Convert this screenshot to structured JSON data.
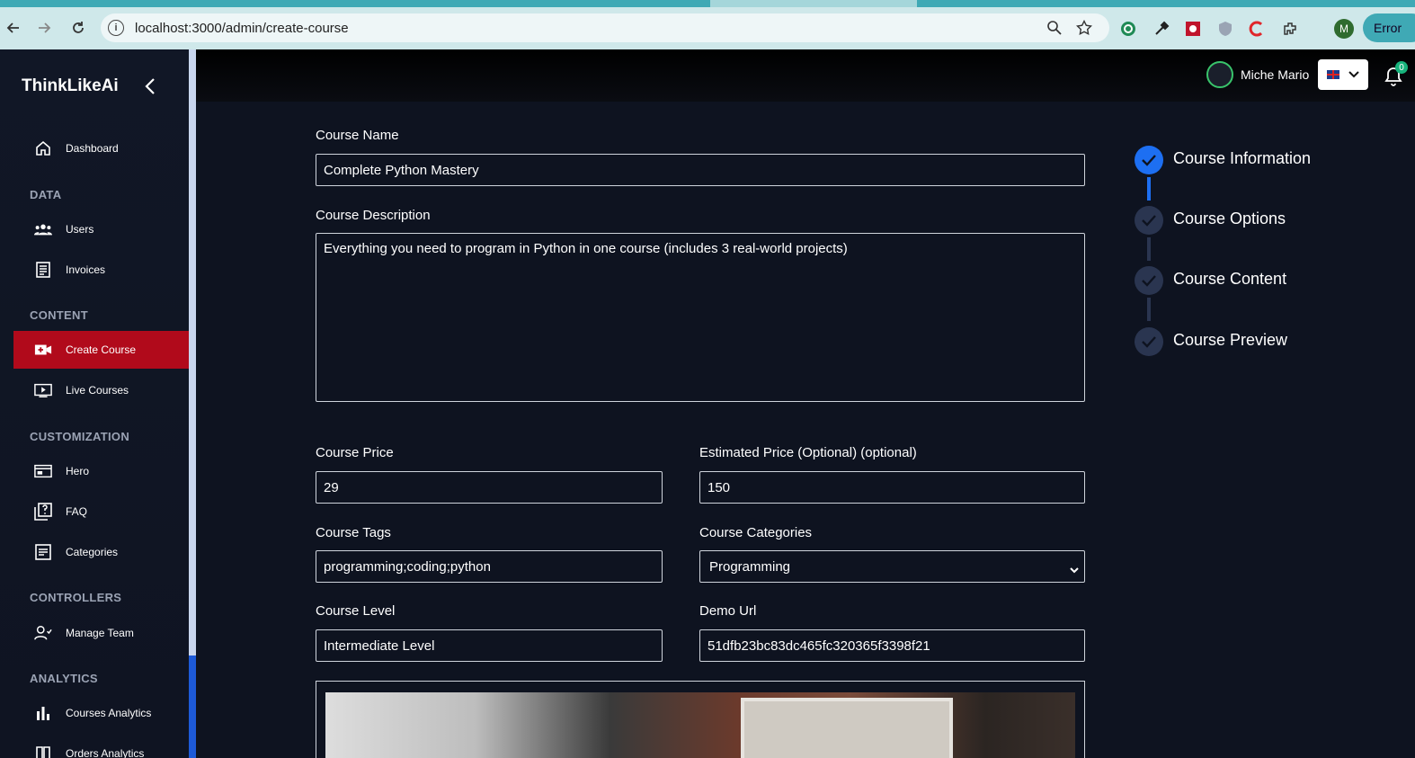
{
  "browser": {
    "url": "localhost:3000/admin/create-course",
    "profile_initial": "M",
    "error_label": "Error"
  },
  "sidebar": {
    "logo": "ThinkLikeAi",
    "sections": [
      {
        "title": "DATA"
      },
      {
        "title": "CONTENT"
      },
      {
        "title": "CUSTOMIZATION"
      },
      {
        "title": "CONTROLLERS"
      },
      {
        "title": "ANALYTICS"
      }
    ],
    "items": [
      {
        "label": "Dashboard",
        "icon": "home-icon"
      },
      {
        "label": "Users",
        "icon": "users-icon"
      },
      {
        "label": "Invoices",
        "icon": "receipt-icon"
      },
      {
        "label": "Create Course",
        "icon": "video-add-icon",
        "active": true
      },
      {
        "label": "Live Courses",
        "icon": "play-screen-icon"
      },
      {
        "label": "Hero",
        "icon": "hero-icon"
      },
      {
        "label": "FAQ",
        "icon": "quiz-icon"
      },
      {
        "label": "Categories",
        "icon": "categories-icon"
      },
      {
        "label": "Manage Team",
        "icon": "team-icon"
      },
      {
        "label": "Courses Analytics",
        "icon": "bar-chart-icon"
      },
      {
        "label": "Orders Analytics",
        "icon": "orders-icon"
      }
    ]
  },
  "topbar": {
    "user_name": "Miche Mario",
    "notification_count": "0"
  },
  "form": {
    "course_name_label": "Course Name",
    "course_name_value": "Complete Python Mastery",
    "course_description_label": "Course Description",
    "course_description_value": "Everything you need to program in Python in one course (includes 3 real-world projects)",
    "course_price_label": "Course Price",
    "course_price_value": "29",
    "estimated_price_label": "Estimated Price (Optional) (optional)",
    "estimated_price_value": "150",
    "course_tags_label": "Course Tags",
    "course_tags_value": "programming;coding;python",
    "course_categories_label": "Course Categories",
    "course_categories_value": "Programming",
    "course_level_label": "Course Level",
    "course_level_value": "Intermediate Level",
    "demo_url_label": "Demo Url",
    "demo_url_value": "51dfb23bc83dc465fc320365f3398f21"
  },
  "stepper": {
    "steps": [
      {
        "label": "Course Information",
        "state": "active"
      },
      {
        "label": "Course Options",
        "state": "pending"
      },
      {
        "label": "Course Content",
        "state": "pending"
      },
      {
        "label": "Course Preview",
        "state": "pending"
      }
    ]
  },
  "colors": {
    "accent_active": "#b10a1b",
    "step_active": "#1d6ff2",
    "step_pending": "#2a3550"
  }
}
